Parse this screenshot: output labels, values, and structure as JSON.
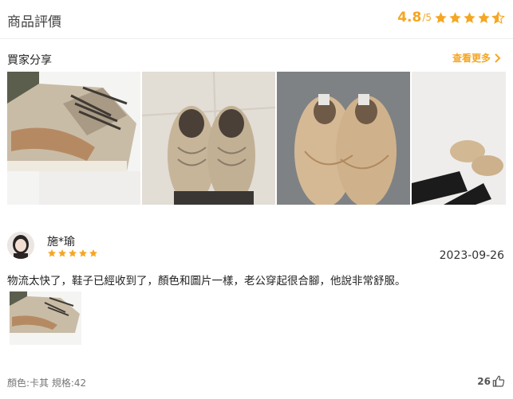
{
  "header": {
    "title": "商品評價",
    "score": "4.8",
    "score_max": "/5",
    "star_rating": 4.5,
    "star_color": "#f5a623"
  },
  "gallery": {
    "title": "買家分享",
    "more_label": "查看更多",
    "more_icon": "chevron-right-icon",
    "photos": [
      {
        "name": "photo-shoe-closeup"
      },
      {
        "name": "photo-shoes-on-floor"
      },
      {
        "name": "photo-shoes-pair-top"
      },
      {
        "name": "photo-shoes-worn"
      }
    ]
  },
  "review": {
    "reviewer": "施*瑜",
    "stars": 5,
    "date": "2023-09-26",
    "text": "物流太快了，鞋子已經收到了，顏色和圖片一樣，老公穿起很合腳，他說非常舒服。",
    "spec": "顏色:卡其 規格:42",
    "likes": "26",
    "like_icon": "thumbs-up-icon"
  }
}
